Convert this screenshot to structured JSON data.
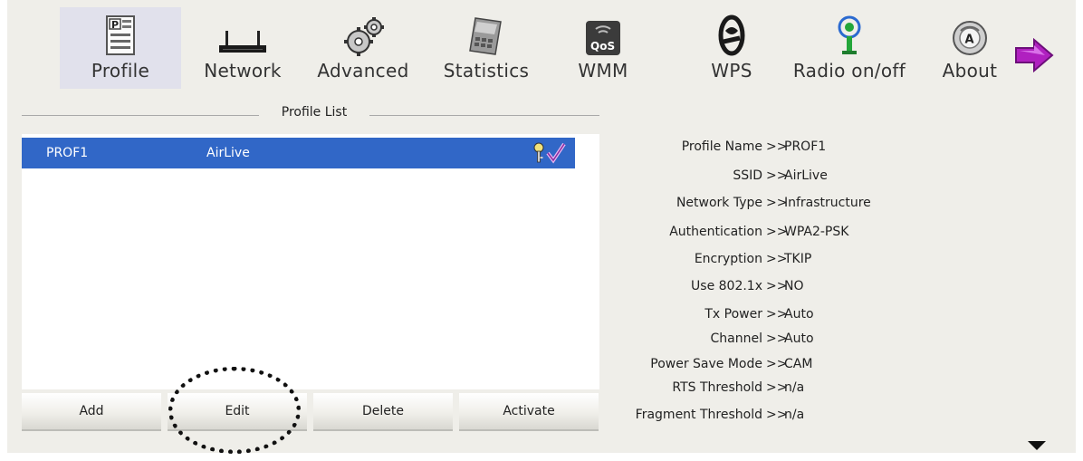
{
  "toolbar": {
    "items": [
      {
        "label": "Profile",
        "icon": "profile-icon",
        "active": true
      },
      {
        "label": "Network",
        "icon": "router-icon"
      },
      {
        "label": "Advanced",
        "icon": "gears-icon"
      },
      {
        "label": "Statistics",
        "icon": "statistics-icon"
      },
      {
        "label": "WMM",
        "icon": "qos-icon",
        "badge": "QoS"
      },
      {
        "label": "WPS",
        "icon": "wps-icon"
      },
      {
        "label": "Radio on/off",
        "icon": "radio-icon"
      },
      {
        "label": "About",
        "icon": "about-icon",
        "badge": "A"
      }
    ],
    "next_icon": "arrow-right-icon",
    "next_color": "#b020c0"
  },
  "profile_list": {
    "title": "Profile List",
    "rows": [
      {
        "profile": "PROF1",
        "ssid": "AirLive",
        "icons": [
          "key-icon",
          "active-check-icon"
        ],
        "selected": true
      }
    ]
  },
  "buttons": {
    "add": "Add",
    "edit": "Edit",
    "delete": "Delete",
    "activate": "Activate"
  },
  "details": {
    "separator": ">>",
    "rows": [
      {
        "key": "Profile Name",
        "value": "PROF1"
      },
      {
        "key": "SSID",
        "value": "AirLive"
      },
      {
        "key": "Network Type",
        "value": "Infrastructure"
      },
      {
        "key": "Authentication",
        "value": "WPA2-PSK"
      },
      {
        "key": "Encryption",
        "value": "TKIP"
      },
      {
        "key": "Use 802.1x",
        "value": "NO"
      },
      {
        "key": "Tx Power",
        "value": "Auto"
      },
      {
        "key": "Channel",
        "value": "Auto"
      },
      {
        "key": "Power Save Mode",
        "value": "CAM"
      },
      {
        "key": "RTS Threshold",
        "value": "n/a"
      },
      {
        "key": "Fragment Threshold",
        "value": "n/a"
      }
    ]
  },
  "colors": {
    "selection": "#3167c7",
    "window_bg": "#efeee9",
    "active_tab": "#e1e1ec"
  },
  "scroll_icon": "triangle-down-icon"
}
